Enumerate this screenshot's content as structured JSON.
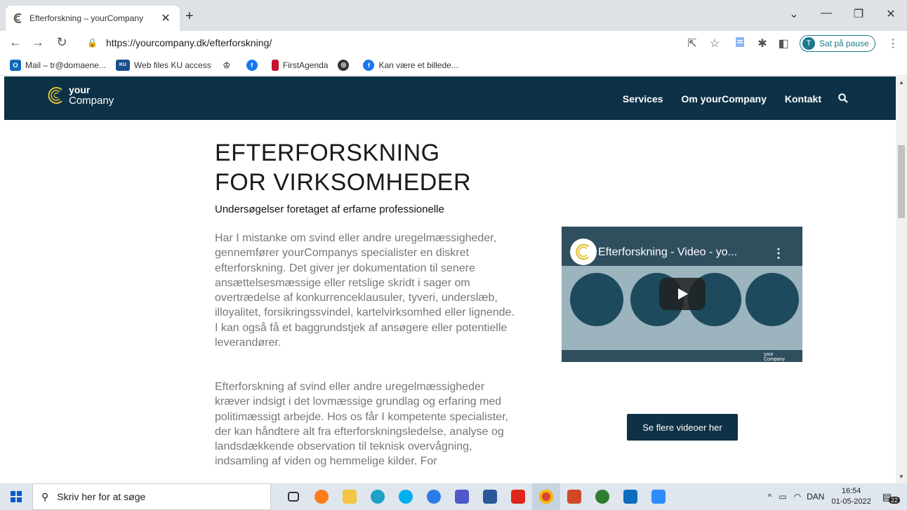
{
  "browser": {
    "tab_title": "Efterforskning – yourCompany",
    "url": "https://yourcompany.dk/efterforskning/",
    "profile_initial": "T",
    "profile_label": "Sat på pause",
    "bookmarks": [
      {
        "label": "Mail – tr@domaene...",
        "color": "#0f6cbd"
      },
      {
        "label": "Web files KU access",
        "color": "#1b4f8a"
      },
      {
        "label": "",
        "color": "#777"
      },
      {
        "label": "",
        "color": "#1877f2"
      },
      {
        "label": "FirstAgenda",
        "color": "#c8102e"
      },
      {
        "label": "",
        "color": "#333"
      },
      {
        "label": "Kan være et billede...",
        "color": "#1877f2"
      }
    ]
  },
  "site": {
    "logo_line1": "your",
    "logo_line2": "Company",
    "menu": [
      "Services",
      "Om yourCompany",
      "Kontakt"
    ],
    "accent": "#e3c33a",
    "nav_bg": "#0d3146"
  },
  "content": {
    "heading_line1": "EFTERFORSKNING",
    "heading_line2": "FOR VIRKSOMHEDER",
    "subheading": "Undersøgelser foretaget af erfarne professionelle",
    "paragraph1": "Har I mistanke om svind eller andre uregelmæssigheder, gennemfører yourCompanys specialister en diskret efterforskning. Det giver jer dokumentation til senere ansættelsesmæssige eller retslige skridt i sager om overtrædelse af konkurrenceklausuler, tyveri, underslæb, illoyalitet, forsikringssvindel, kartelvirksomhed eller lignende. I kan også få et baggrundstjek af ansøgere eller potentielle leverandører.",
    "paragraph2": "Efterforskning af svind eller andre uregelmæssigheder kræver indsigt i det lovmæssige grundlag og erfaring med politimæssigt arbejde. Hos os får I kompetente specialister, der kan håndtere alt fra efterforskningsledelse, analyse og landsdækkende observation til teknisk overvågning, indsamling af viden og hemmelige kilder. For",
    "video_title": "Efterforskning - Video - yo...",
    "video_watermark_line1": "your",
    "video_watermark_line2": "Company",
    "cta_label": "Se flere videoer her"
  },
  "taskbar": {
    "search_placeholder": "Skriv her for at søge",
    "language": "DAN",
    "time": "16:54",
    "date": "01-05-2022",
    "notifications": "22"
  }
}
